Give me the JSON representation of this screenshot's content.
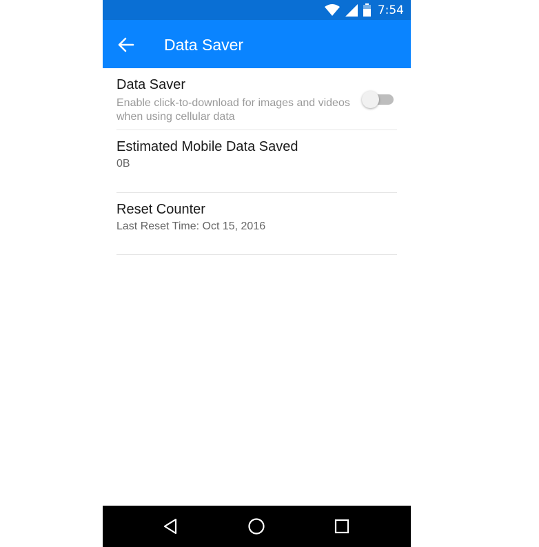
{
  "status_bar": {
    "time": "7:54",
    "icons": [
      "wifi-icon",
      "cell-signal-icon",
      "battery-icon"
    ]
  },
  "app_bar": {
    "title": "Data Saver",
    "back_icon": "arrow-left-icon",
    "color": "#0a84ff"
  },
  "settings": {
    "data_saver": {
      "title": "Data Saver",
      "description": "Enable click-to-download for images and videos when using cellular data",
      "enabled": false
    },
    "estimated_saved": {
      "title": "Estimated Mobile Data Saved",
      "value": "0B"
    },
    "reset_counter": {
      "title": "Reset Counter",
      "subtitle": "Last Reset Time: Oct 15, 2016"
    }
  },
  "nav_bar": {
    "icons": [
      "back-triangle-icon",
      "home-circle-icon",
      "recents-square-icon"
    ]
  }
}
